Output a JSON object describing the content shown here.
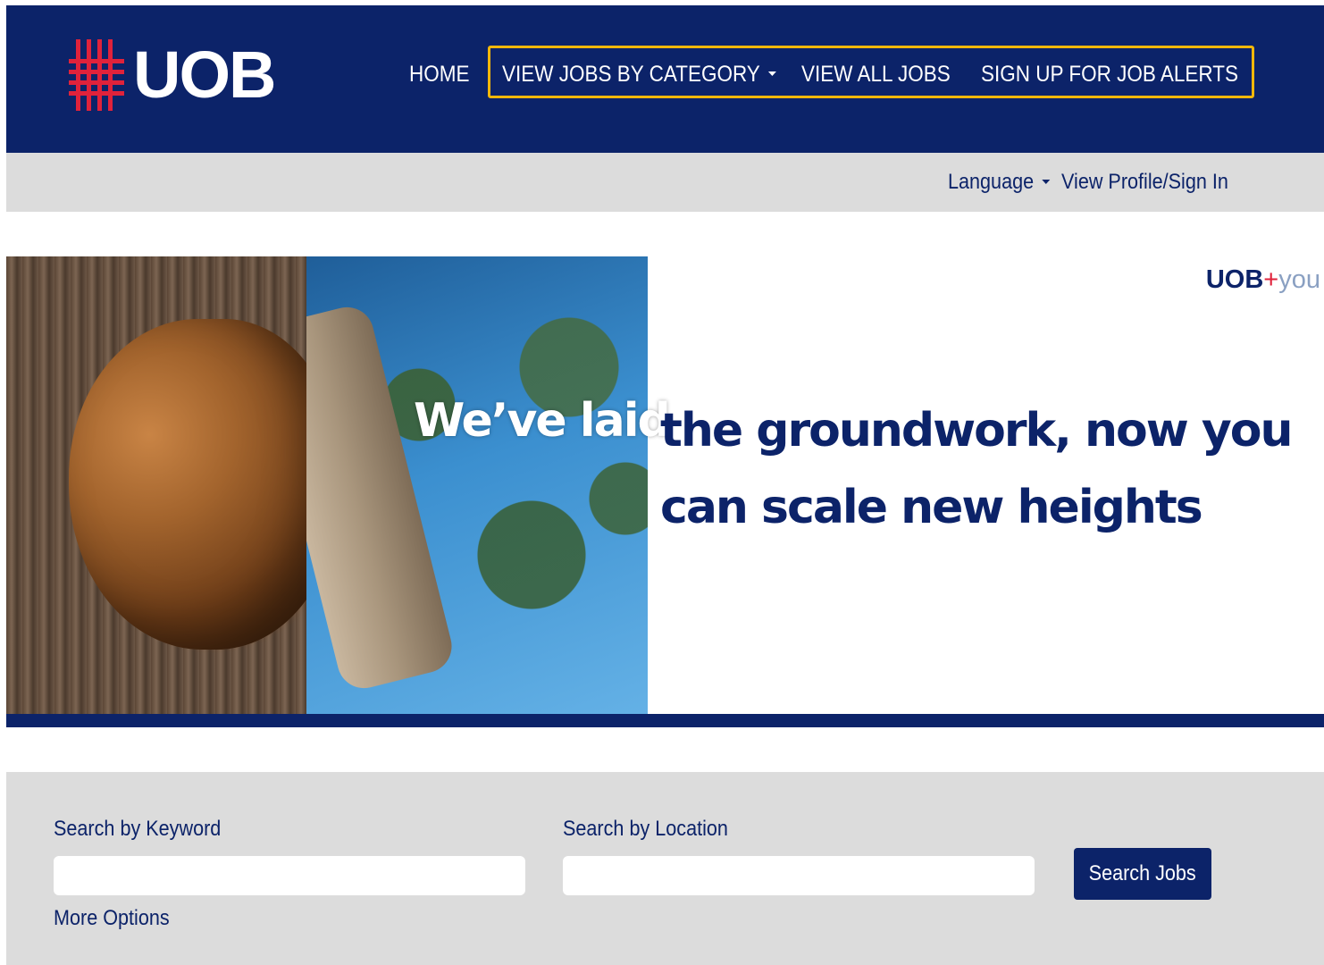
{
  "header": {
    "logo_text": "UOB",
    "nav": {
      "home": "HOME",
      "view_jobs_by_category": "VIEW JOBS BY CATEGORY",
      "view_all_jobs": "VIEW ALL JOBS",
      "sign_up_for_job_alerts": "SIGN UP FOR JOB ALERTS"
    },
    "colors": {
      "background": "#0c2369",
      "highlight_border": "#f3b70a",
      "logo_red": "#e0223b"
    }
  },
  "utility_bar": {
    "language": "Language",
    "profile_sign_in": "View Profile/Sign In"
  },
  "banner": {
    "brand_uob": "UOB",
    "brand_plus": "+",
    "brand_you": "you",
    "overlay_text": "We’ve laid",
    "headline": "the groundwork, now you can scale new heights"
  },
  "search": {
    "keyword_label": "Search by Keyword",
    "keyword_value": "",
    "location_label": "Search by Location",
    "location_value": "",
    "search_button_label": "Search Jobs",
    "more_options": "More Options"
  },
  "icons": {
    "logo_mark": "uob-logo-icon",
    "dropdown_caret": "caret-down-icon"
  }
}
